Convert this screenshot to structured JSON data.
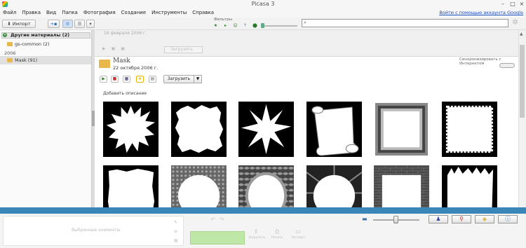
{
  "window": {
    "title": "Picasa 3"
  },
  "menu": [
    "Файл",
    "Правка",
    "Вид",
    "Папка",
    "Фотография",
    "Создание",
    "Инструменты",
    "Справка"
  ],
  "login_link": "Войти с помощью аккаунта Google",
  "toolbar": {
    "import_label": "Импорт",
    "filters_label": "Фильтры"
  },
  "search": {
    "value": "",
    "placeholder": ""
  },
  "sidebar": {
    "header": "Другие материалы (2)",
    "items": [
      {
        "label": "gs-common (2)"
      }
    ],
    "year": "2006",
    "selected": {
      "label": "Mask (91)"
    }
  },
  "previous_album": {
    "date": "16 февраля 2006 г.",
    "upload_label": "Загрузить"
  },
  "album": {
    "name": "Mask",
    "date": "22 октября 2006 г.",
    "sync_label": "Синхронизировать с Интернетом",
    "upload_label": "Загрузить",
    "add_description": "Добавить описание"
  },
  "thumbnails": [
    "splash",
    "rough",
    "starburst",
    "scroll",
    "frame",
    "stamp",
    "rough-edge",
    "circle-pattern",
    "oval-ornate",
    "circle-burst",
    "brick",
    "torn-edge"
  ],
  "bottom": {
    "tray_label": "Выбранные элементы",
    "action_1": "Загрузить",
    "action_2": "Печать",
    "action_3": "Экспорт"
  },
  "colors": {
    "accent_band": "#3a86b8",
    "share_button": "#bfe7a8"
  }
}
